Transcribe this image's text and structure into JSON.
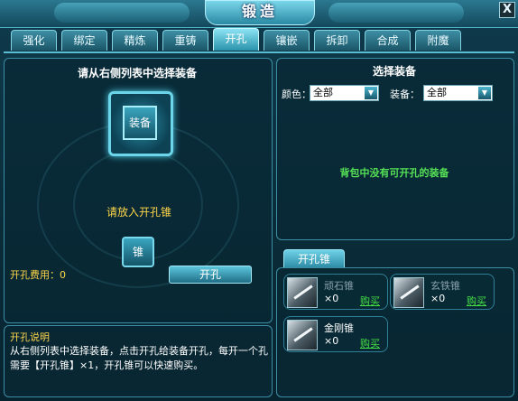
{
  "window": {
    "title": "锻造",
    "close_glyph": "X"
  },
  "tabs": [
    {
      "label": "强化",
      "active": false
    },
    {
      "label": "绑定",
      "active": false
    },
    {
      "label": "精炼",
      "active": false
    },
    {
      "label": "重铸",
      "active": false
    },
    {
      "label": "开孔",
      "active": true
    },
    {
      "label": "镶嵌",
      "active": false
    },
    {
      "label": "拆卸",
      "active": false
    },
    {
      "label": "合成",
      "active": false
    },
    {
      "label": "附魔",
      "active": false
    }
  ],
  "left_panel": {
    "heading": "请从右侧列表中选择装备",
    "equip_slot_label": "装备",
    "hint": "请放入开孔锥",
    "cone_slot_label": "锥",
    "fee_label": "开孔费用：0",
    "action_button": "开孔"
  },
  "description": {
    "heading": "开孔说明",
    "text": "从右侧列表中选择装备，点击开孔给装备开孔，每开一个孔需要【开孔锥】×1，开孔锥可以快速购买。"
  },
  "right_panel": {
    "heading": "选择装备",
    "color_label": "颜色：",
    "color_value": "全部",
    "equip_label": "装备：",
    "equip_value": "全部",
    "empty_message": "背包中没有可开孔的装备"
  },
  "shop": {
    "tab_label": "开孔锥",
    "items": [
      {
        "name": "顽石锥",
        "qty": "×0",
        "buy": "购买"
      },
      {
        "name": "玄铁锥",
        "qty": "×0",
        "buy": "购买"
      },
      {
        "name": "金刚锥",
        "qty": "×0",
        "buy": "购买"
      }
    ]
  },
  "colors": {
    "accent": "#6cd5e9",
    "hint_yellow": "#ffd64a",
    "buy_green": "#44e044"
  }
}
